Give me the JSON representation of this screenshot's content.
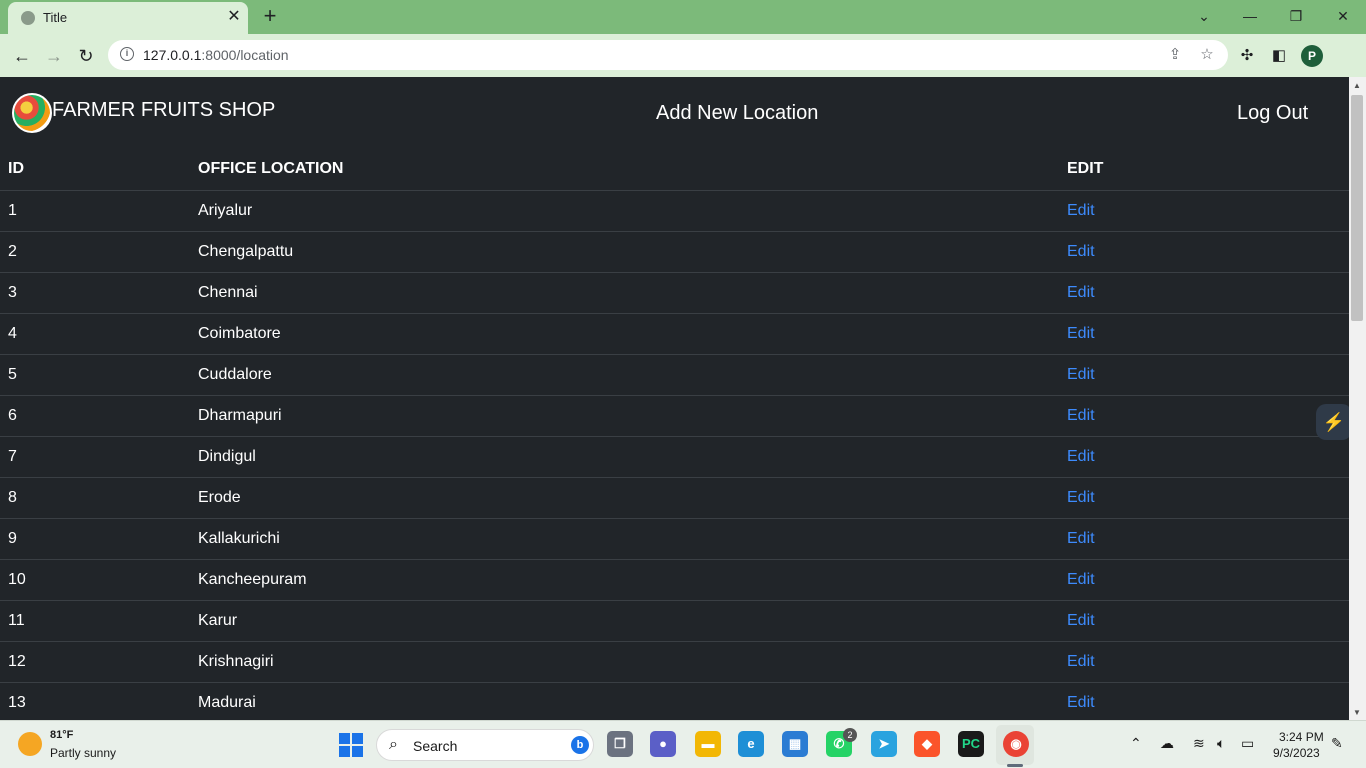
{
  "browser": {
    "tab_title": "Title",
    "tab_close": "✕",
    "new_tab": "+",
    "url_host": "127.0.0.1",
    "url_rest": ":8000/location",
    "window_controls": {
      "dropdown": "⌄",
      "minimize": "—",
      "restore": "❐",
      "close": "✕"
    },
    "profile_initial": "P"
  },
  "navbar": {
    "brand": "FARMER FRUITS SHOP",
    "add_link": "Add New Location",
    "logout": "Log Out"
  },
  "table": {
    "headers": [
      "ID",
      "OFFICE LOCATION",
      "EDIT"
    ],
    "rows": [
      {
        "id": "1",
        "location": "Ariyalur",
        "edit": "Edit"
      },
      {
        "id": "2",
        "location": "Chengalpattu",
        "edit": "Edit"
      },
      {
        "id": "3",
        "location": "Chennai",
        "edit": "Edit"
      },
      {
        "id": "4",
        "location": "Coimbatore",
        "edit": "Edit"
      },
      {
        "id": "5",
        "location": "Cuddalore",
        "edit": "Edit"
      },
      {
        "id": "6",
        "location": "Dharmapuri",
        "edit": "Edit"
      },
      {
        "id": "7",
        "location": "Dindigul",
        "edit": "Edit"
      },
      {
        "id": "8",
        "location": "Erode",
        "edit": "Edit"
      },
      {
        "id": "9",
        "location": "Kallakurichi",
        "edit": "Edit"
      },
      {
        "id": "10",
        "location": "Kancheepuram",
        "edit": "Edit"
      },
      {
        "id": "11",
        "location": "Karur",
        "edit": "Edit"
      },
      {
        "id": "12",
        "location": "Krishnagiri",
        "edit": "Edit"
      },
      {
        "id": "13",
        "location": "Madurai",
        "edit": "Edit"
      }
    ]
  },
  "taskbar": {
    "weather_temp": "81°F",
    "weather_desc": "Partly sunny",
    "search_label": "Search",
    "whatsapp_badge": "2",
    "time": "3:24 PM",
    "date": "9/3/2023"
  },
  "colors": {
    "page_bg": "#212529",
    "link": "#3d8bfd",
    "chrome_accent": "#7cba7a"
  }
}
